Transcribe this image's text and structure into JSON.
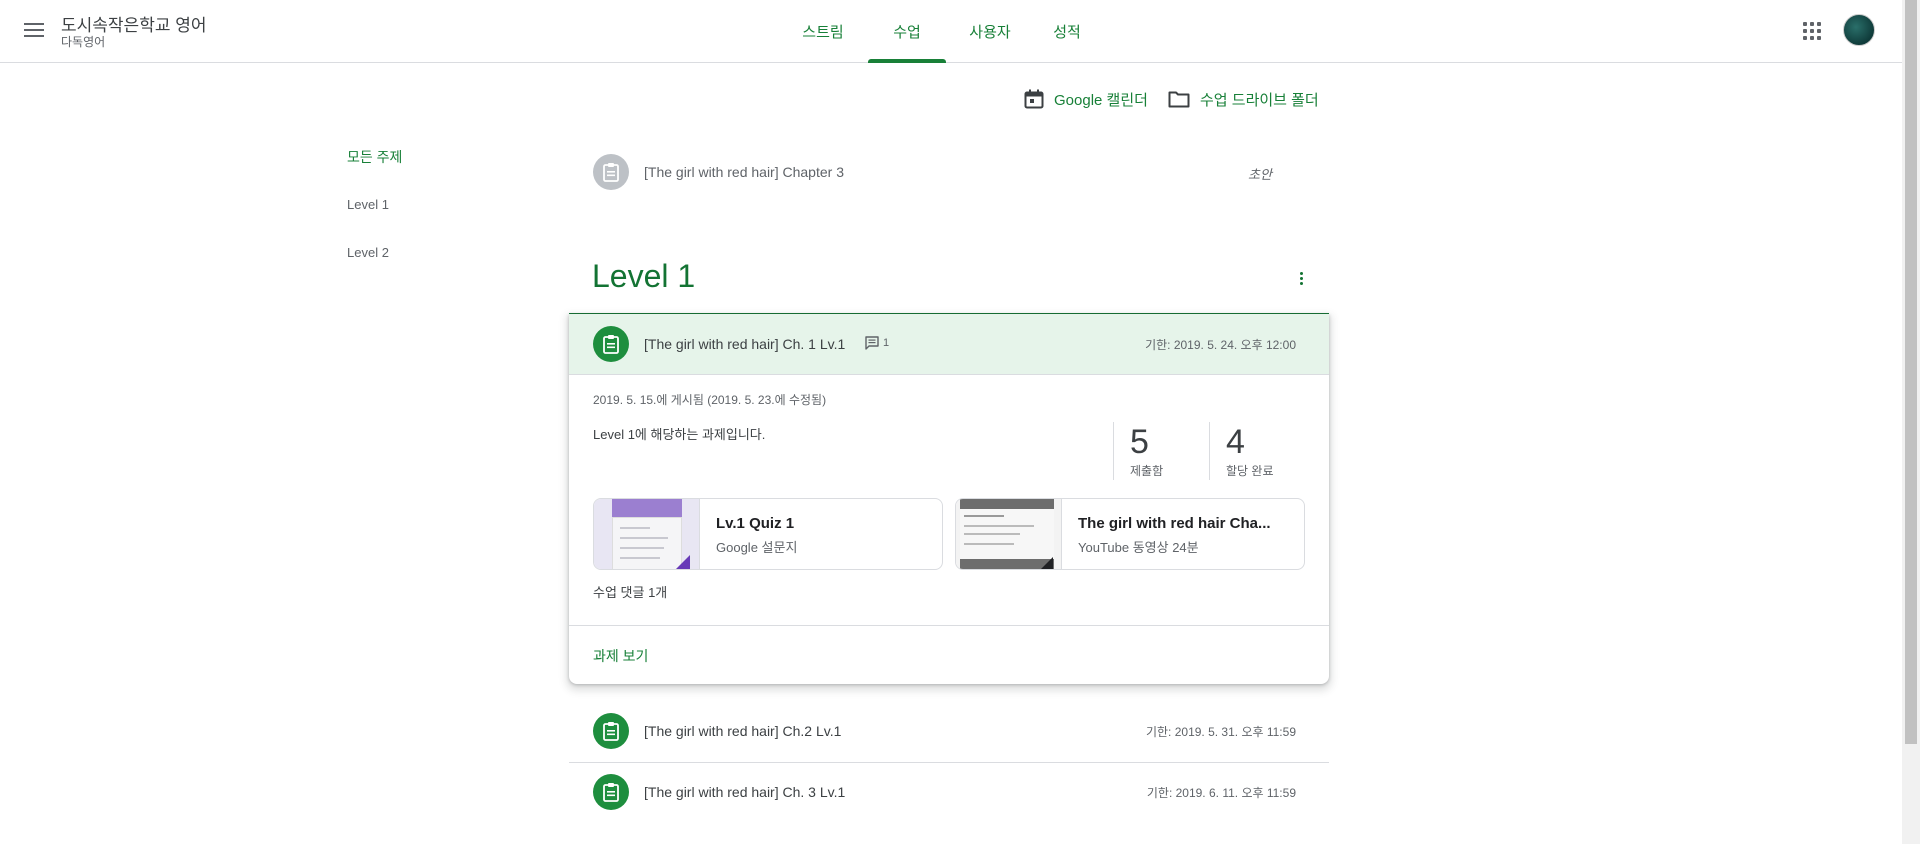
{
  "header": {
    "course_title": "도시속작은학교 영어",
    "course_subtitle": "다독영어",
    "tabs": [
      {
        "label": "스트림"
      },
      {
        "label": "수업"
      },
      {
        "label": "사용자"
      },
      {
        "label": "성적"
      }
    ],
    "active_tab": "수업"
  },
  "actions": {
    "calendar_label": "Google 캘린더",
    "drive_label": "수업 드라이브 폴더"
  },
  "topics": [
    {
      "label": "모든 주제"
    },
    {
      "label": "Level 1"
    },
    {
      "label": "Level 2"
    }
  ],
  "draft": {
    "title": "[The girl with red hair] Chapter 3",
    "status": "초안"
  },
  "level": {
    "heading": "Level 1"
  },
  "expanded": {
    "title": "[The girl with red hair] Ch. 1 Lv.1",
    "comment_count": "1",
    "due": "기한: 2019. 5. 24. 오후 12:00",
    "posted": "2019. 5. 15.에 게시됨 (2019. 5. 23.에 수정됨)",
    "description": "Level 1에 해당하는 과제입니다.",
    "stats": [
      {
        "num": "5",
        "label": "제출함"
      },
      {
        "num": "4",
        "label": "할당 완료"
      }
    ],
    "attachments": [
      {
        "title": "Lv.1 Quiz 1",
        "subtitle": "Google 설문지"
      },
      {
        "title": "The girl with red hair Cha...",
        "subtitle": "YouTube 동영상   24분"
      }
    ],
    "comments_label": "수업 댓글 1개",
    "view_button": "과제 보기"
  },
  "assignments": [
    {
      "title": "[The girl with red hair] Ch.2 Lv.1",
      "due": "기한: 2019. 5. 31. 오후 11:59"
    },
    {
      "title": "[The girl with red hair] Ch. 3 Lv.1",
      "due": "기한: 2019. 6. 11. 오후 11:59"
    }
  ],
  "colors": {
    "accent": "#188038",
    "accent_dark": "#137333",
    "assignment_icon_bg": "#1e8e3e",
    "highlight_bg": "#e6f4ea"
  }
}
